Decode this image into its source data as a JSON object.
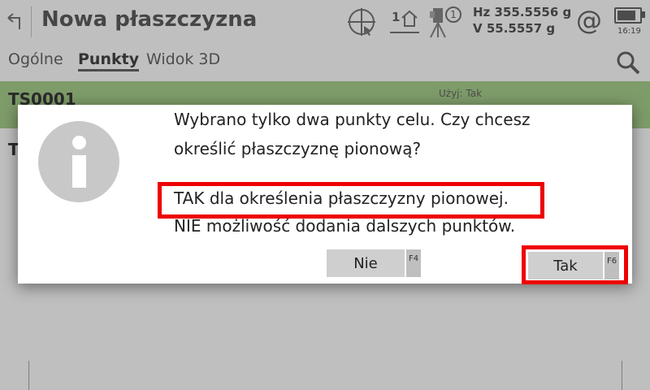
{
  "header": {
    "title": "Nowa płaszczyzna",
    "prism_label": "1",
    "face_label": "1",
    "hz_line": "Hz 355.5556 g",
    "v_line": "V    55.5557 g",
    "at_symbol": "@",
    "battery_level": 0.85,
    "time": "16:19"
  },
  "tabs": [
    {
      "label": "Ogólne",
      "active": false
    },
    {
      "label": "Punkty",
      "active": true
    },
    {
      "label": "Widok 3D",
      "active": false
    }
  ],
  "list": {
    "row1": {
      "title": "TS0001",
      "meta": "Użyj:  Tak"
    },
    "row2": {
      "title": "T"
    }
  },
  "dialog": {
    "line1": "Wybrano tylko dwa punkty celu. Czy chcesz",
    "line2": "określić płaszczyznę pionową?",
    "line3": "TAK dla określenia płaszczyzny pionowej.",
    "line4": "NIE możliwość dodania dalszych punktów.",
    "no_button": "Nie",
    "no_fkey": "F4",
    "yes_button": "Tak",
    "yes_fkey": "F6"
  },
  "colors": {
    "highlight": "#ee0000",
    "selected_row": "#a9d18e",
    "button": "#cfcfcf"
  }
}
